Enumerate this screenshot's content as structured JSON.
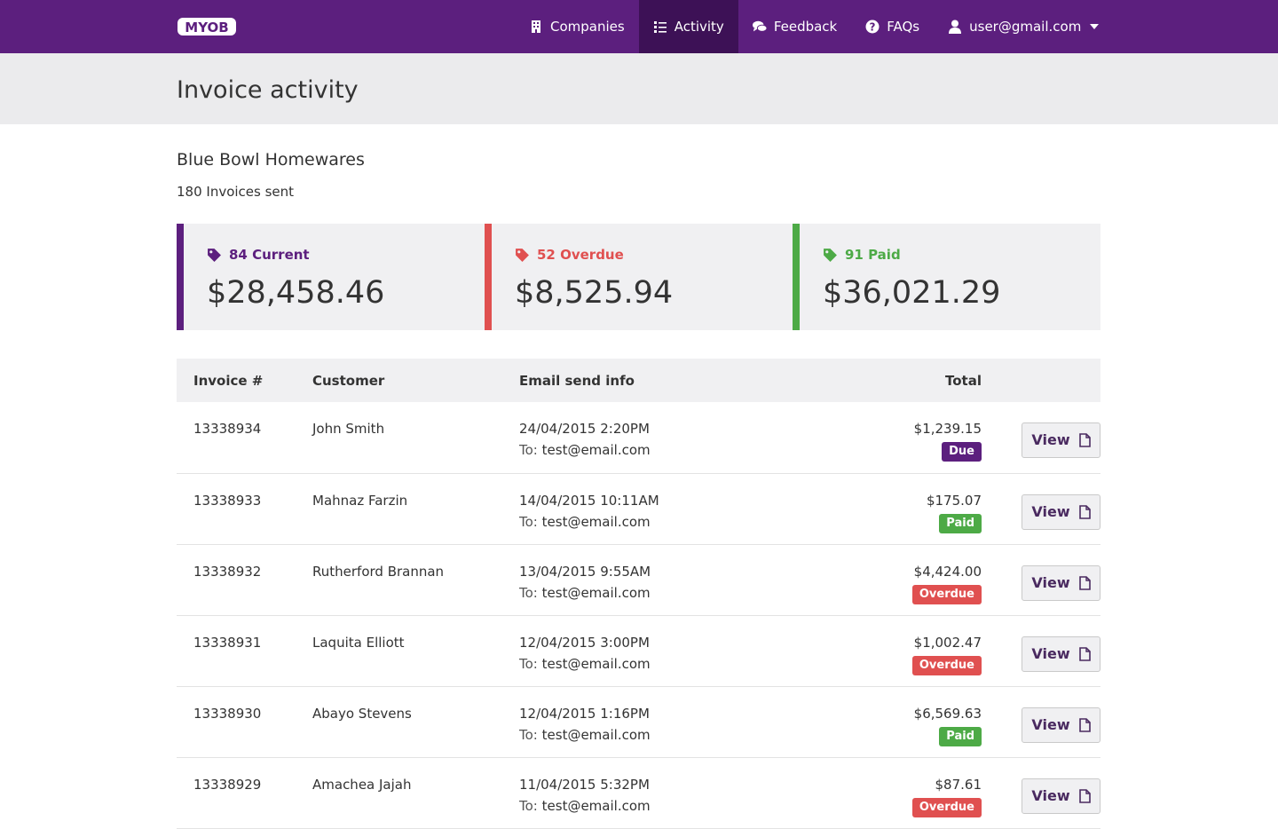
{
  "brand": {
    "logo_text": "MYOB",
    "primary": "#5c1f7e",
    "active": "#3d1156",
    "overdue": "#e05050",
    "paid": "#4daa46"
  },
  "nav": {
    "companies": "Companies",
    "activity": "Activity",
    "feedback": "Feedback",
    "faqs": "FAQs",
    "user": "user@gmail.com"
  },
  "page": {
    "title": "Invoice activity"
  },
  "company": {
    "name": "Blue Bowl Homewares",
    "sent": "180 Invoices sent"
  },
  "cards": [
    {
      "label": "84 Current",
      "amount": "$28,458.46",
      "color": "#5c1f7e"
    },
    {
      "label": "52 Overdue",
      "amount": "$8,525.94",
      "color": "#e05050"
    },
    {
      "label": "91 Paid",
      "amount": "$36,021.29",
      "color": "#4daa46"
    }
  ],
  "table": {
    "headers": {
      "invoice": "Invoice #",
      "customer": "Customer",
      "email": "Email send info",
      "total": "Total"
    },
    "to_label": "To:",
    "view_label": "View",
    "rows": [
      {
        "invoice": "13338934",
        "customer": "John Smith",
        "date": "24/04/2015 2:20PM",
        "email": "test@email.com",
        "total": "$1,239.15",
        "status": "Due"
      },
      {
        "invoice": "13338933",
        "customer": "Mahnaz Farzin",
        "date": "14/04/2015 10:11AM",
        "email": "test@email.com",
        "total": "$175.07",
        "status": "Paid"
      },
      {
        "invoice": "13338932",
        "customer": "Rutherford Brannan",
        "date": "13/04/2015 9:55AM",
        "email": "test@email.com",
        "total": "$4,424.00",
        "status": "Overdue"
      },
      {
        "invoice": "13338931",
        "customer": "Laquita Elliott",
        "date": "12/04/2015 3:00PM",
        "email": "test@email.com",
        "total": "$1,002.47",
        "status": "Overdue"
      },
      {
        "invoice": "13338930",
        "customer": "Abayo Stevens",
        "date": "12/04/2015 1:16PM",
        "email": "test@email.com",
        "total": "$6,569.63",
        "status": "Paid"
      },
      {
        "invoice": "13338929",
        "customer": "Amachea Jajah",
        "date": "11/04/2015 5:32PM",
        "email": "test@email.com",
        "total": "$87.61",
        "status": "Overdue"
      }
    ]
  }
}
